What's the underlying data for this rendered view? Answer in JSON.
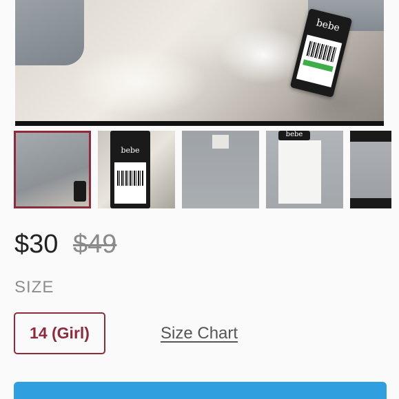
{
  "product": {
    "hero_tag_brand": "bebe",
    "thumb_tag_brand": "bebe",
    "thumb_tag_brand_2": "bebe",
    "thumbnails": [
      {
        "id": "thumb-1",
        "selected": true
      },
      {
        "id": "thumb-2",
        "selected": false
      },
      {
        "id": "thumb-3",
        "selected": false
      },
      {
        "id": "thumb-4",
        "selected": false
      },
      {
        "id": "thumb-5",
        "selected": false
      }
    ]
  },
  "pricing": {
    "price": "$30",
    "original_price": "$49"
  },
  "size": {
    "heading": "SIZE",
    "selected_option": "14 (Girl)",
    "size_chart_link": "Size Chart"
  },
  "colors": {
    "accent": "#8e2a3a",
    "cta": "#2f9fe0"
  }
}
